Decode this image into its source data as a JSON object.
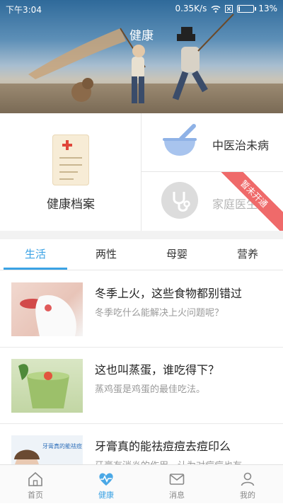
{
  "status_bar": {
    "time": "下午3:04",
    "network_speed": "0.35K/s",
    "battery": "13%",
    "battery_level": 0.13
  },
  "hero": {
    "title": "健康"
  },
  "features": {
    "health_records": {
      "label": "健康档案",
      "icon": "document-icon"
    },
    "tcm": {
      "label": "中医治未病",
      "icon": "mortar-pestle-icon"
    },
    "family_doctor": {
      "label": "家庭医生",
      "icon": "stethoscope-icon",
      "badge": "暂未开通"
    }
  },
  "tabs": [
    {
      "label": "生活",
      "active": true
    },
    {
      "label": "两性",
      "active": false
    },
    {
      "label": "母婴",
      "active": false
    },
    {
      "label": "营养",
      "active": false
    }
  ],
  "articles": [
    {
      "title": "冬季上火，这些食物都别错过",
      "desc": "冬季吃什么能解决上火问题呢？"
    },
    {
      "title": "这也叫蒸蛋，谁吃得下？",
      "desc": "蒸鸡蛋是鸡蛋的最佳吃法。"
    },
    {
      "title": "牙膏真的能祛痘痘去痘印么",
      "desc": "牙膏有消炎的作用，认为对痘痘也有",
      "thumb_caption": "牙膏真的能祛痘"
    }
  ],
  "bottom_nav": [
    {
      "label": "首页",
      "icon": "home-icon",
      "active": false
    },
    {
      "label": "健康",
      "icon": "heart-pulse-icon",
      "active": true
    },
    {
      "label": "消息",
      "icon": "mail-icon",
      "active": false
    },
    {
      "label": "我的",
      "icon": "person-icon",
      "active": false
    }
  ],
  "colors": {
    "accent": "#3aa2e4",
    "badge": "#ef6a6a",
    "tcm_bowl": "#a8c4ee"
  }
}
